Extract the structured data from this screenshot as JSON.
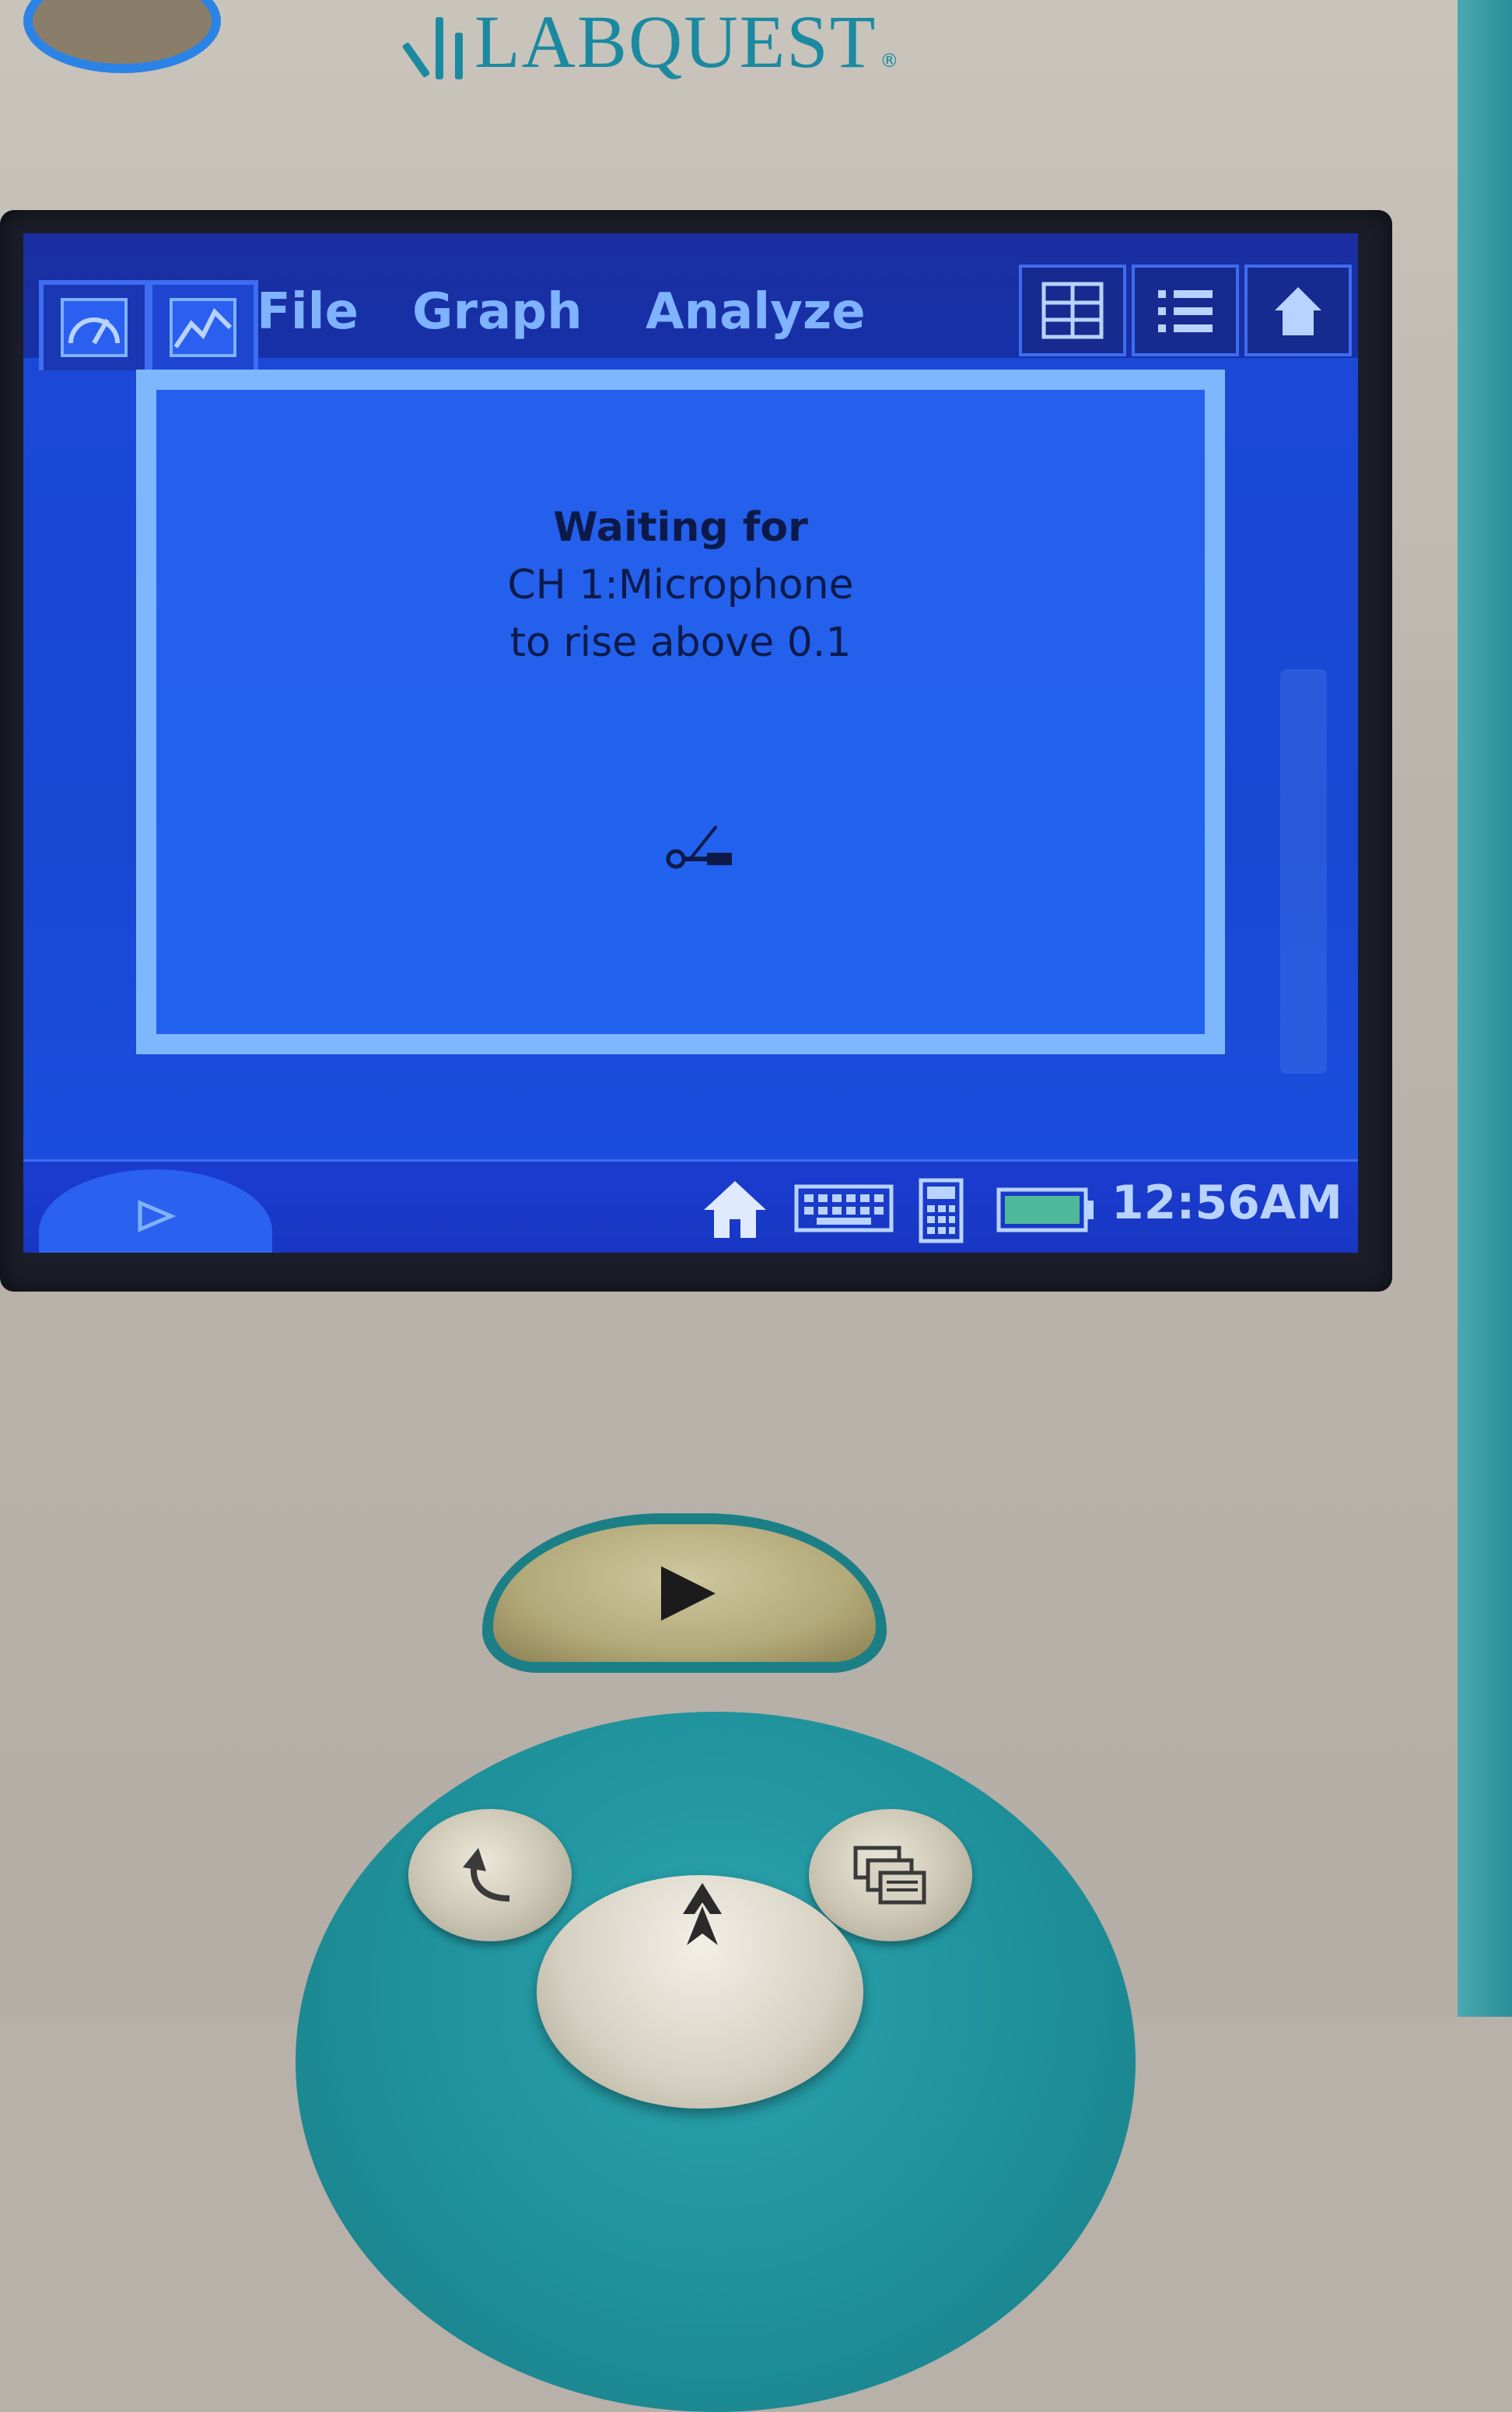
{
  "device": {
    "brand": "LABQUEST",
    "registered": "®"
  },
  "menubar": {
    "menus": [
      "File",
      "Graph",
      "Analyze"
    ],
    "app_tabs": [
      "meter-icon",
      "graph-icon"
    ],
    "tools": [
      "table-view-icon",
      "list-view-icon",
      "home-shortcut-icon"
    ]
  },
  "dialog": {
    "line1": "Waiting for",
    "line2": "CH 1:Microphone",
    "line3": "to rise above 0.1",
    "icon": "trigger-icon"
  },
  "statusbar": {
    "icons": [
      "home-icon",
      "keyboard-icon",
      "calculator-icon",
      "battery-icon"
    ],
    "clock": "12:56AM"
  },
  "colors": {
    "screen_blue": "#1c49d8",
    "menu_text": "#7fb2ff",
    "dialog_border": "#7fb7ff",
    "device_teal": "#1d8e98",
    "device_gray": "#bab4ac"
  }
}
